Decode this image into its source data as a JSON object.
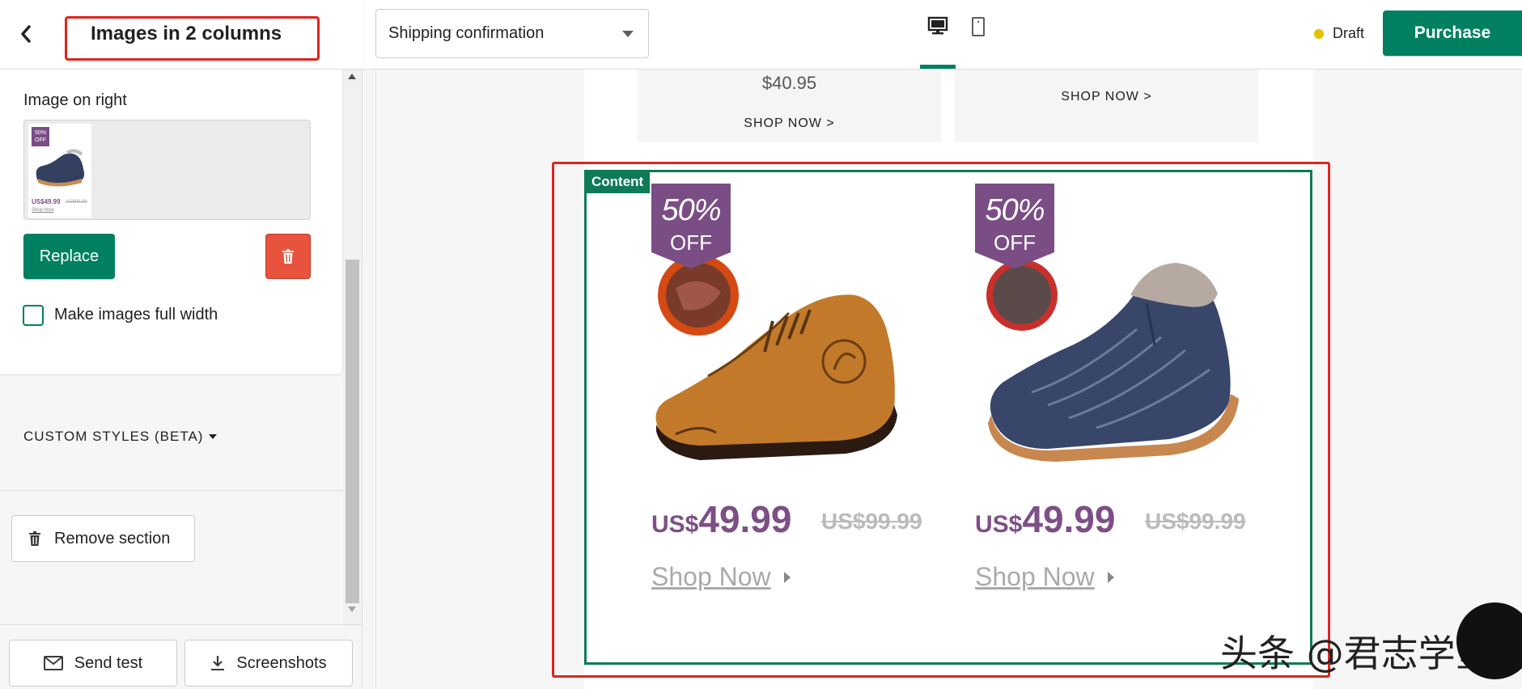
{
  "sidebar": {
    "header_title": "Images in 2 columns",
    "image_right_label": "Image on right",
    "thumb": {
      "badge": "50% OFF",
      "price": "US$49.99",
      "old_price": "US$99.99",
      "shop": "Shop Now"
    },
    "replace_label": "Replace",
    "full_width_label": "Make images full width",
    "custom_styles_label": "CUSTOM STYLES (BETA)",
    "remove_section_label": "Remove section",
    "footer": {
      "send_test_label": "Send test",
      "screenshots_label": "Screenshots"
    }
  },
  "topbar": {
    "template_selected": "Shipping confirmation",
    "status_label": "Draft",
    "status_color": "#e5c100",
    "purchase_label": "Purchase",
    "view_tabs": [
      "desktop-icon",
      "mobile-icon"
    ]
  },
  "canvas": {
    "previous_row": {
      "price": "$40.95",
      "shop_left": "SHOP NOW >",
      "shop_right": "SHOP NOW >"
    },
    "content_tag": "Content",
    "products": [
      {
        "badge_num": "50%",
        "badge_off": "OFF",
        "currency": "US$",
        "price": "49.99",
        "old_price": "US$99.99",
        "shop": "Shop Now"
      },
      {
        "badge_num": "50%",
        "badge_off": "OFF",
        "currency": "US$",
        "price": "49.99",
        "old_price": "US$99.99",
        "shop": "Shop Now"
      }
    ],
    "watermark": "头条 @君志学堂"
  },
  "colors": {
    "accent": "#008060",
    "danger": "#e7533d",
    "highlight": "#e0241d",
    "badge": "#7a4e85"
  }
}
